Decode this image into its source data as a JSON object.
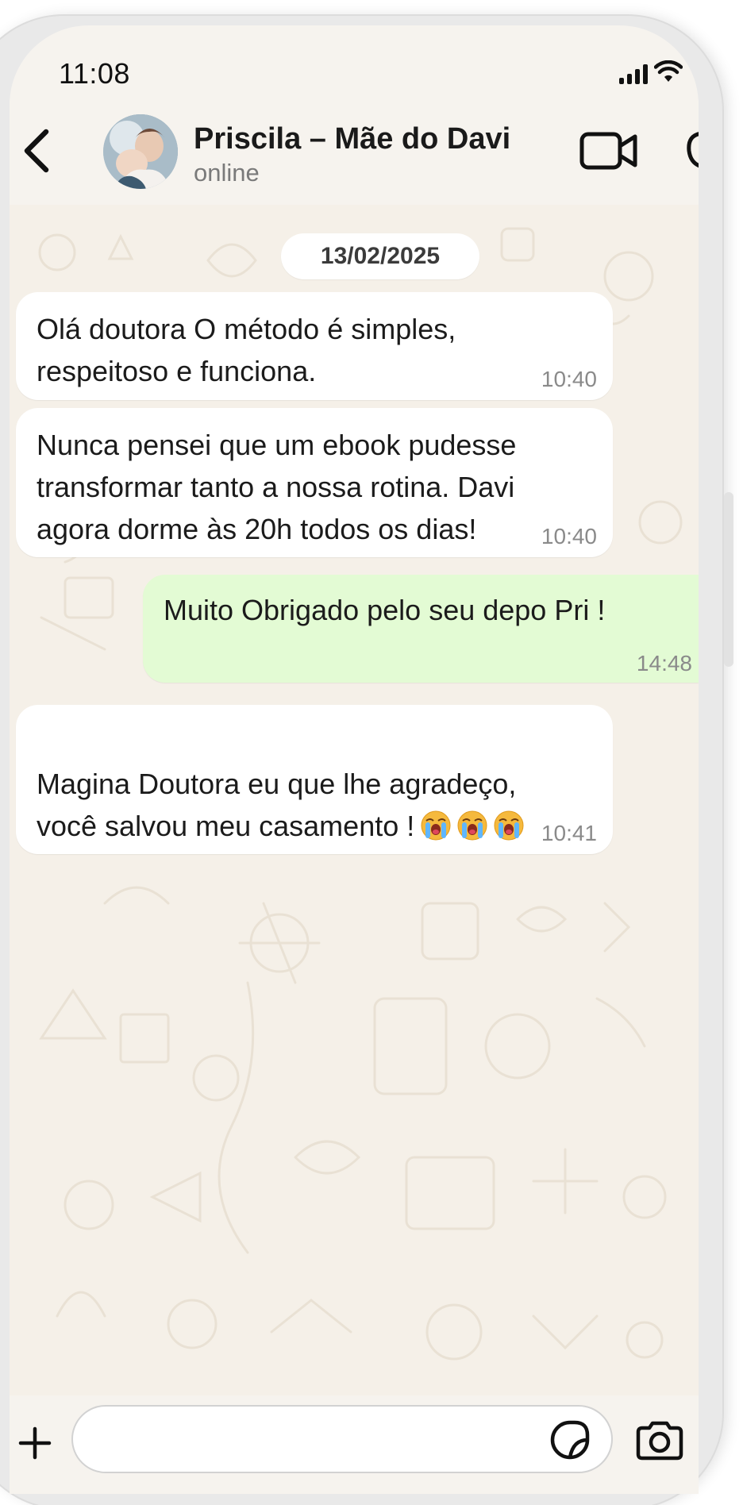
{
  "status_bar": {
    "time": "11:08"
  },
  "header": {
    "contact_name": "Priscila – Mãe do Davi",
    "contact_status": "online"
  },
  "chat": {
    "date": "13/02/2025",
    "messages": [
      {
        "direction": "in",
        "text": "Olá doutora O método é simples,\nrespeitoso e funciona.",
        "time": "10:40"
      },
      {
        "direction": "in",
        "text": "Nunca pensei que um ebook pudesse\ntransformar tanto a nossa rotina. Davi\nagora dorme às 20h todos os dias!",
        "time": "10:40"
      },
      {
        "direction": "out",
        "text": "Muito Obrigado pelo seu depo Pri !",
        "time": "14:48"
      },
      {
        "direction": "in",
        "text": "Magina Doutora eu que lhe agradeço,\nvocê salvou meu casamento !",
        "emojis": [
          "loudly-crying-face",
          "loudly-crying-face",
          "loudly-crying-face"
        ],
        "time": "10:41"
      }
    ]
  },
  "input_bar": {
    "placeholder": ""
  },
  "colors": {
    "chat_background": "#f5f0e8",
    "incoming_bubble": "#ffffff",
    "outgoing_bubble": "#e3fbd4",
    "header_background": "#f6f3ee"
  },
  "icons": [
    "back-icon",
    "video-call-icon",
    "phone-call-icon",
    "plus-icon",
    "sticker-icon",
    "camera-icon",
    "signal-icon",
    "wifi-icon"
  ]
}
